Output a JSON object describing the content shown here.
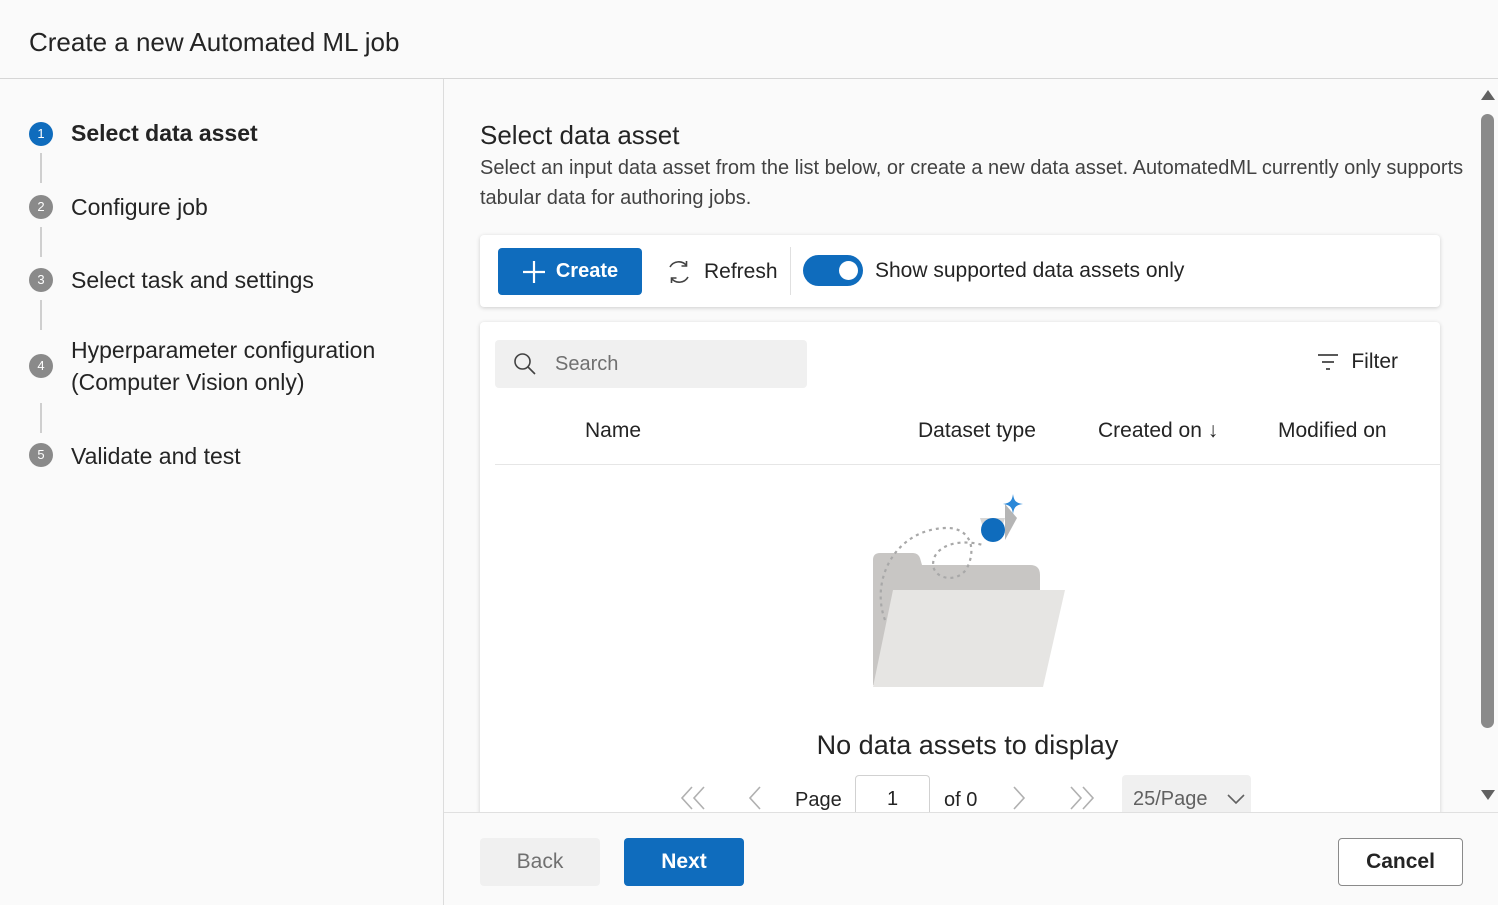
{
  "header": {
    "title": "Create a new Automated ML job"
  },
  "steps": [
    {
      "num": "1",
      "label": "Select data asset",
      "active": true
    },
    {
      "num": "2",
      "label": "Configure job"
    },
    {
      "num": "3",
      "label": "Select task and settings"
    },
    {
      "num": "4",
      "label_line1": "Hyperparameter configuration",
      "label_line2": "(Computer Vision only)"
    },
    {
      "num": "5",
      "label": "Validate and test"
    }
  ],
  "main": {
    "title": "Select data asset",
    "description": "Select an input data asset from the list below, or create a new data asset. AutomatedML currently only supports tabular data for authoring jobs."
  },
  "toolbar": {
    "create_label": "Create",
    "refresh_label": "Refresh",
    "toggle_label": "Show supported data assets only",
    "toggle_on": true
  },
  "table": {
    "search_placeholder": "Search",
    "filter_label": "Filter",
    "columns": [
      "Name",
      "Dataset type",
      "Created on ↓",
      "Modified on"
    ],
    "empty_message": "No data assets to display"
  },
  "pager": {
    "page_label": "Page",
    "page_value": "1",
    "of_label": "of 0",
    "page_size": "25/Page"
  },
  "footer": {
    "back_label": "Back",
    "next_label": "Next",
    "cancel_label": "Cancel"
  },
  "colors": {
    "accent": "#0f6cbd",
    "step_inactive": "#8a8a8a"
  },
  "icons": [
    "plus-icon",
    "refresh-icon",
    "search-icon",
    "filter-icon",
    "first-page-icon",
    "prev-page-icon",
    "next-page-icon",
    "last-page-icon",
    "chevron-down-icon",
    "empty-folder-illustration"
  ]
}
